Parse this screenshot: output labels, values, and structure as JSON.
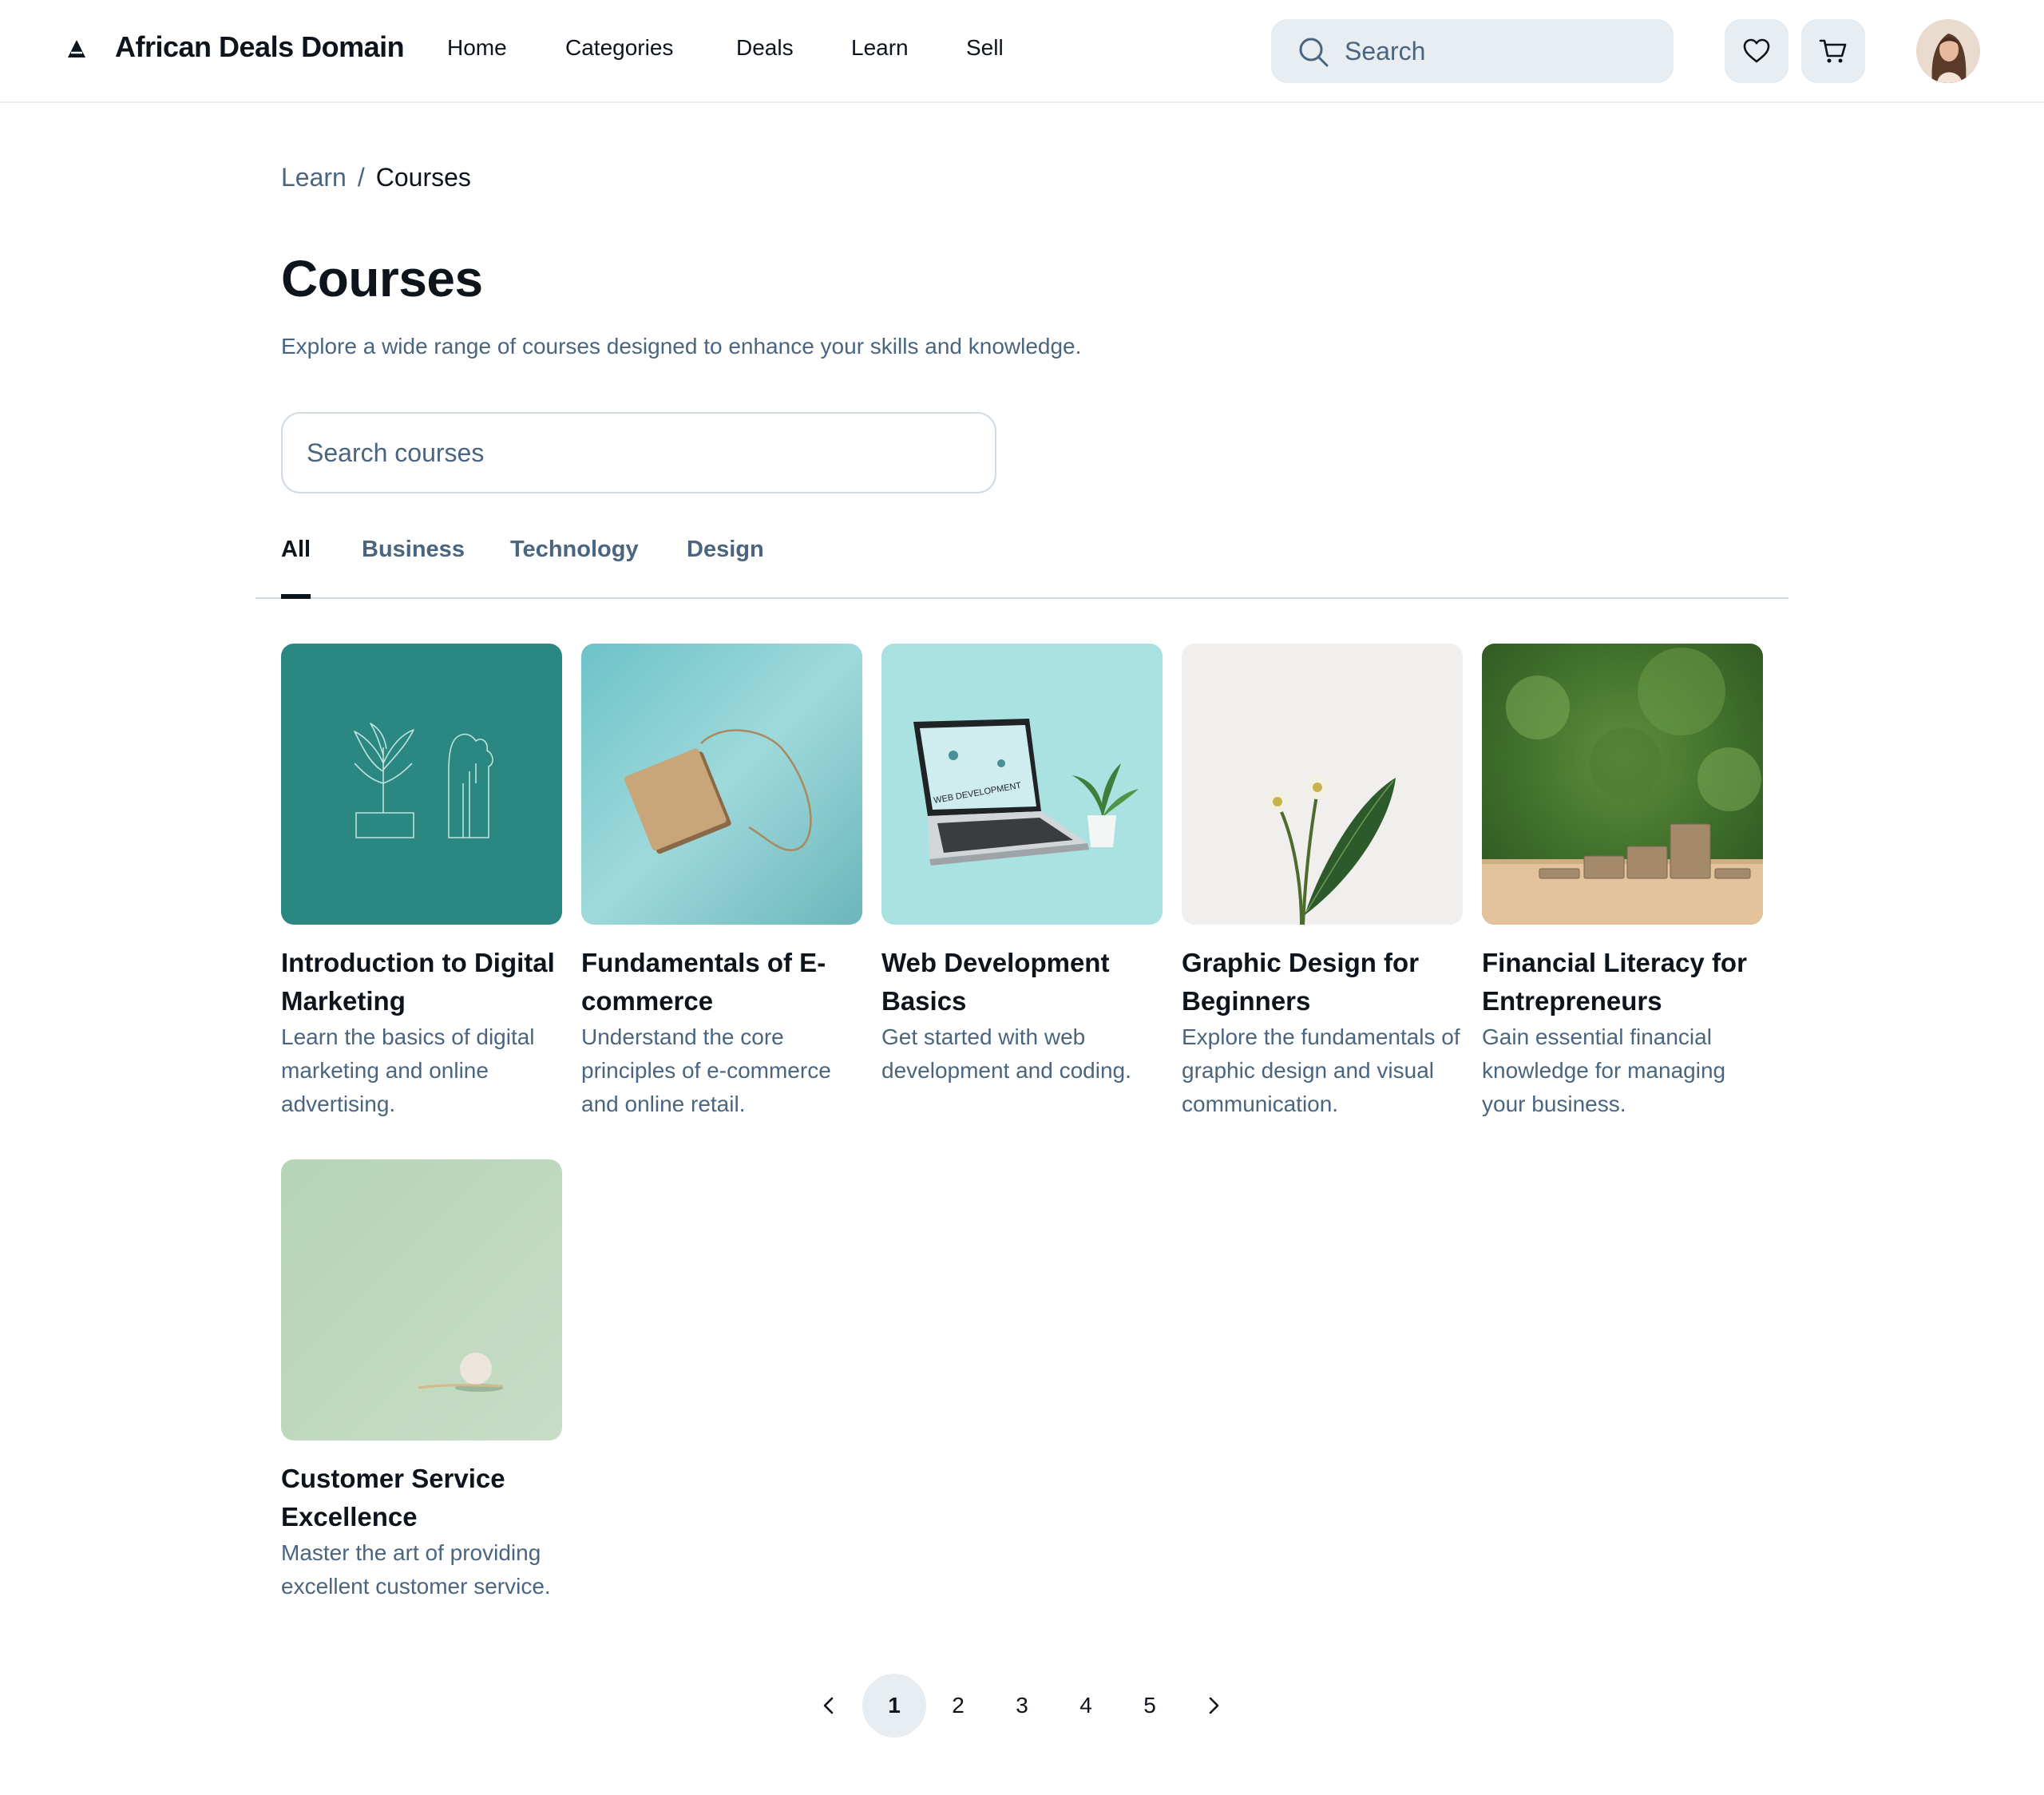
{
  "header": {
    "brand": "African Deals Domain",
    "nav": [
      "Home",
      "Categories",
      "Deals",
      "Learn",
      "Sell"
    ],
    "search_placeholder": "Search"
  },
  "breadcrumb": {
    "parent": "Learn",
    "separator": "/",
    "current": "Courses"
  },
  "page": {
    "title": "Courses",
    "subtitle": "Explore a wide range of courses designed to enhance your skills and knowledge.",
    "search_placeholder": "Search courses"
  },
  "tabs": {
    "items": [
      "All",
      "Business",
      "Technology",
      "Design"
    ],
    "active": "All"
  },
  "courses": [
    {
      "title": "Introduction to Digital Marketing",
      "description": "Learn the basics of digital marketing and online advertising.",
      "image": "teal line-art plants"
    },
    {
      "title": "Fundamentals of E-commerce",
      "description": "Understand the core principles of e-commerce and online retail.",
      "image": "kraft tag on teal"
    },
    {
      "title": "Web Development Basics",
      "description": "Get started with web development and coding.",
      "image": "laptop with plant",
      "image_text": "WEB DEVELOPMENT"
    },
    {
      "title": "Graphic Design for Beginners",
      "description": "Explore the fundamentals of graphic design and visual communication.",
      "image": "flowers and leaf"
    },
    {
      "title": "Financial Literacy for Entrepreneurs",
      "description": "Gain essential financial knowledge for managing your business.",
      "image": "coin stacks"
    },
    {
      "title": "Customer Service Excellence",
      "description": "Master the art of providing excellent customer service.",
      "image": "sphere on sage green"
    }
  ],
  "pagination": {
    "pages": [
      "1",
      "2",
      "3",
      "4",
      "5"
    ],
    "current": "1",
    "prev_icon": "chevron-left-icon",
    "next_icon": "chevron-right-icon"
  },
  "colors": {
    "text_primary": "#0d141c",
    "text_secondary": "#4a6580",
    "surface": "#e8edf2",
    "border": "#d0dbe6"
  }
}
